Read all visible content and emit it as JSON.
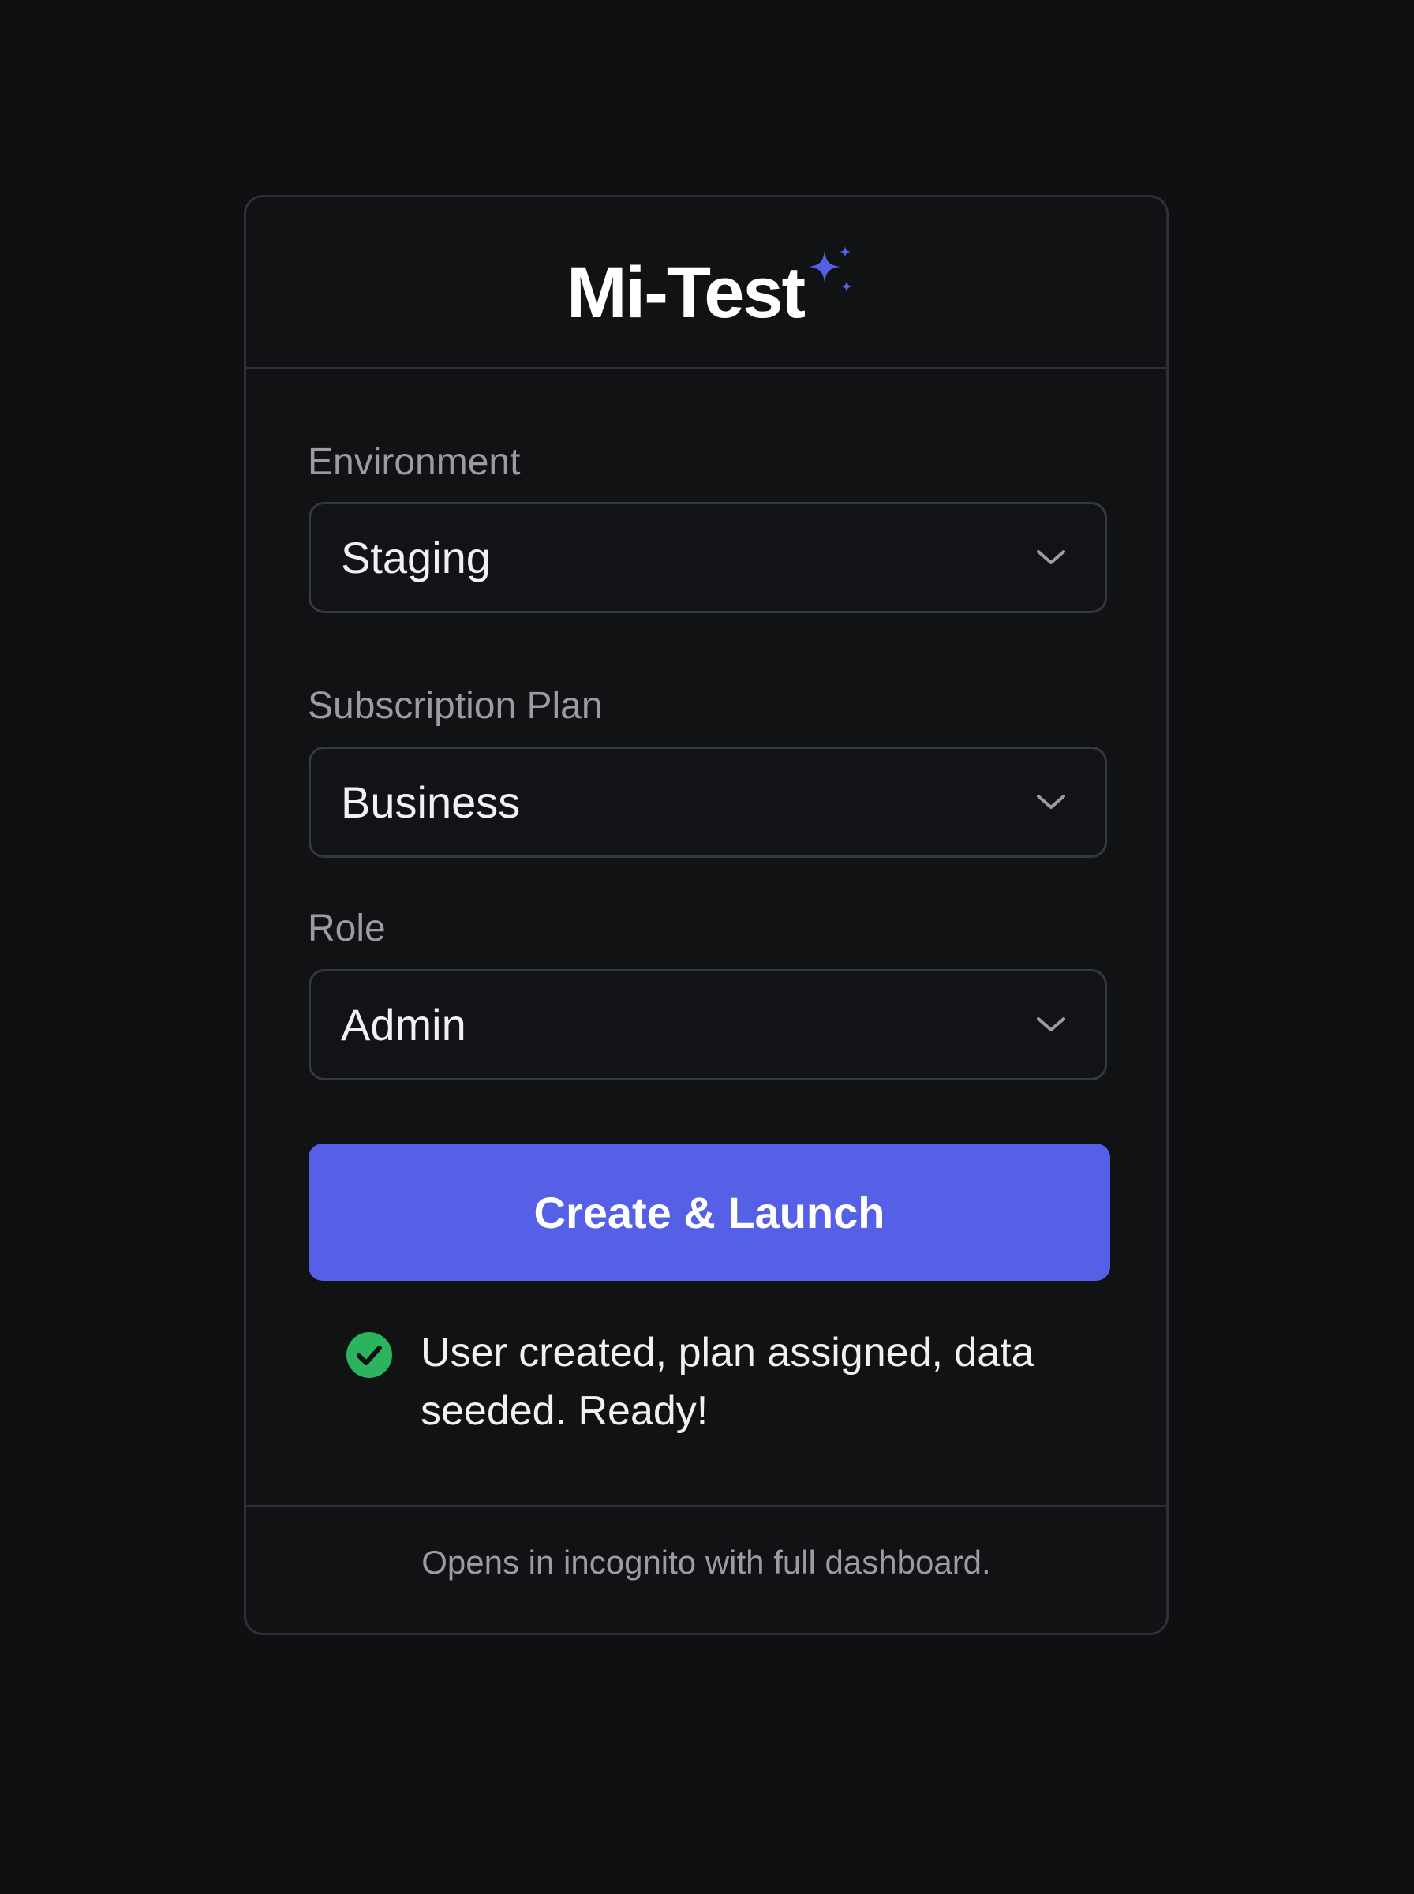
{
  "app": {
    "title": "Mi-Test"
  },
  "form": {
    "environment": {
      "label": "Environment",
      "value": "Staging"
    },
    "plan": {
      "label": "Subscription Plan",
      "value": "Business"
    },
    "role": {
      "label": "Role",
      "value": "Admin"
    },
    "submit_label": "Create & Launch"
  },
  "status": {
    "message": "User created, plan assigned, data seeded. Ready!",
    "icon": "check-circle-icon"
  },
  "footer": {
    "note": "Opens in incognito with full dashboard."
  },
  "colors": {
    "background": "#0f1011",
    "accent": "#5660e6",
    "success": "#2bb45d",
    "border": "#2e2f3b"
  }
}
